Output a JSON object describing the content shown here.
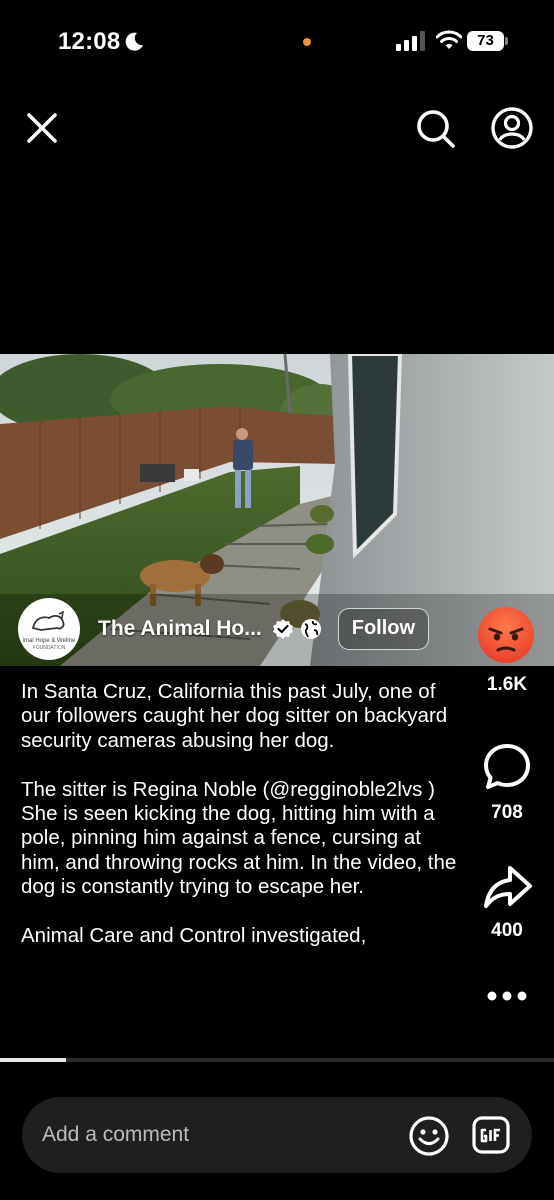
{
  "status": {
    "time": "12:08",
    "battery": "73"
  },
  "header": {
    "close": "close",
    "search": "search",
    "profile": "profile"
  },
  "post": {
    "page_name": "The Animal Ho...",
    "follow_label": "Follow",
    "avatar_text_line1": "imal Hope & Wellne",
    "avatar_text_line2": "FOUNDATION",
    "caption_paragraphs": [
      "In Santa Cruz, California this past July, one of our followers caught her dog sitter on backyard security cameras abusing her dog.",
      "The sitter is Regina Noble (@regginoble2lvs ) She is seen kicking the dog, hitting him with a pole, pinning him against a fence, cursing at him, and throwing rocks at him. In the video, the dog is constantly trying to escape her.",
      "Animal Care and Control investigated,"
    ],
    "reaction_count": "1.6K",
    "comment_count": "708",
    "share_count": "400",
    "progress": 0.12
  },
  "icons": {
    "angry_reaction": "angry-face-icon",
    "comment": "comment-bubble-icon",
    "share": "share-arrow-icon",
    "more": "more-dots-icon"
  },
  "comment_bar": {
    "placeholder": "Add a comment"
  },
  "colors": {
    "background": "#000000",
    "reaction": "#f0553c",
    "status_dot": "#f0933a"
  }
}
